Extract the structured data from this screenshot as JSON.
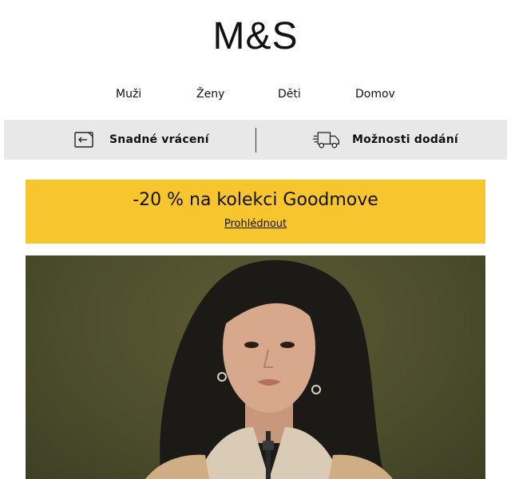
{
  "brand": {
    "logo_text": "M&S"
  },
  "nav": {
    "items": [
      "Muži",
      "Ženy",
      "Děti",
      "Domov"
    ]
  },
  "service_bar": {
    "returns_label": "Snadné vrácení",
    "returns_icon": "return-package-icon",
    "delivery_label": "Možnosti dodání",
    "delivery_icon": "delivery-truck-icon"
  },
  "promo": {
    "title": "-20 % na kolekci Goodmove",
    "link_label": "Prohlédnout",
    "background": "#f7c52e"
  },
  "hero": {
    "image_name": "model-photo"
  }
}
